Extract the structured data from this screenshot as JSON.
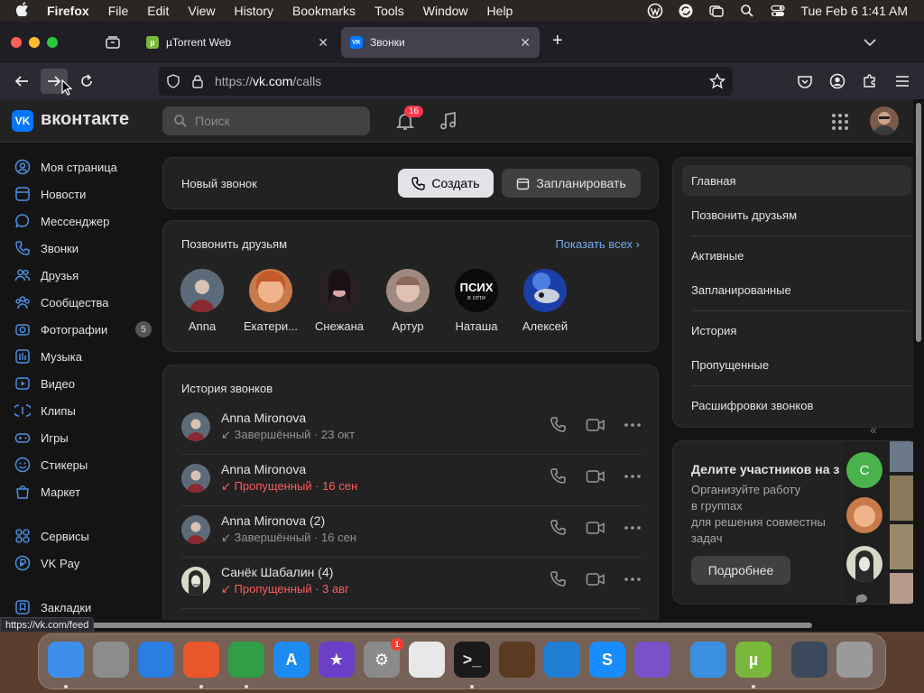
{
  "menubar": {
    "app": "Firefox",
    "items": [
      "File",
      "Edit",
      "View",
      "History",
      "Bookmarks",
      "Tools",
      "Window",
      "Help"
    ],
    "clock": "Tue Feb 6  1:41 AM"
  },
  "tabs": [
    {
      "title": "µTorrent Web",
      "favicon": "µ"
    },
    {
      "title": "Звонки",
      "favicon": "VK"
    }
  ],
  "url": {
    "prefix": "https://",
    "host": "vk.com",
    "path": "/calls"
  },
  "vk": {
    "brand": "вконтакте",
    "logo": "VK",
    "search_placeholder": "Поиск",
    "notifications_count": "16"
  },
  "sidebar": {
    "items": [
      {
        "label": "Моя страница",
        "icon": "user-circle-icon"
      },
      {
        "label": "Новости",
        "icon": "news-icon"
      },
      {
        "label": "Мессенджер",
        "icon": "message-icon"
      },
      {
        "label": "Звонки",
        "icon": "phone-icon"
      },
      {
        "label": "Друзья",
        "icon": "friends-icon"
      },
      {
        "label": "Сообщества",
        "icon": "communities-icon"
      },
      {
        "label": "Фотографии",
        "icon": "photo-icon",
        "count": "5"
      },
      {
        "label": "Музыка",
        "icon": "music-icon"
      },
      {
        "label": "Видео",
        "icon": "video-icon"
      },
      {
        "label": "Клипы",
        "icon": "clips-icon"
      },
      {
        "label": "Игры",
        "icon": "gamepad-icon"
      },
      {
        "label": "Стикеры",
        "icon": "sticker-icon"
      },
      {
        "label": "Маркет",
        "icon": "market-icon"
      },
      {
        "label": "Сервисы",
        "icon": "services-icon"
      },
      {
        "label": "VK Pay",
        "icon": "vkpay-icon"
      },
      {
        "label": "Закладки",
        "icon": "bookmark-icon"
      }
    ]
  },
  "new_call": {
    "title": "Новый звонок",
    "create": "Создать",
    "schedule": "Запланировать"
  },
  "friends": {
    "title": "Позвонить друзьям",
    "show_all": "Показать всех",
    "list": [
      {
        "name": "Anna",
        "color": "#9a8c86"
      },
      {
        "name": "Екатери...",
        "color": "#e08e5f"
      },
      {
        "name": "Снежана",
        "color": "#6b4a52"
      },
      {
        "name": "Артур",
        "color": "#b89a8c"
      },
      {
        "name": "Наташа",
        "color": "#0a0a0a",
        "avatar_text": "ПСИХ",
        "avatar_sub": "в сети"
      },
      {
        "name": "Алексей",
        "color": "#2f4fb0"
      }
    ]
  },
  "history": {
    "title": "История звонков",
    "rows": [
      {
        "name": "Anna Mironova",
        "status": "Завершённый · 23 окт",
        "missed": false
      },
      {
        "name": "Anna Mironova",
        "status": "Пропущенный · 16 сен",
        "missed": true
      },
      {
        "name": "Anna Mironova (2)",
        "status": "Завершённый · 16 сен",
        "missed": false
      },
      {
        "name": "Санёк Шабалин (4)",
        "status": "Пропущенный · 3 авг",
        "missed": true
      }
    ]
  },
  "right_nav": {
    "items": [
      "Главная",
      "Позвонить друзьям",
      "Активные",
      "Запланированные",
      "История",
      "Пропущенные",
      "Расшифровки звонков"
    ]
  },
  "promo": {
    "title": "Делите участников на з",
    "text_lines": [
      "Организуйте работу",
      "в группах",
      "для решения совместны",
      "задач"
    ],
    "button": "Подробнее",
    "avatar_letter": "С"
  },
  "status_link": "https://vk.com/feed",
  "dock": {
    "apps": [
      {
        "name": "finder-icon",
        "color": "#3d8ee8",
        "glyph": ""
      },
      {
        "name": "launchpad-icon",
        "color": "#8c8c8c",
        "glyph": ""
      },
      {
        "name": "safari-icon",
        "color": "#2a7de1",
        "glyph": ""
      },
      {
        "name": "firefox-icon",
        "color": "#e8562a",
        "glyph": ""
      },
      {
        "name": "chrome-icon",
        "color": "#2f9e46",
        "glyph": ""
      },
      {
        "name": "app-store-icon",
        "color": "#1c8bf2",
        "glyph": "A"
      },
      {
        "name": "imovie-icon",
        "color": "#6c3fc9",
        "glyph": "★"
      },
      {
        "name": "system-settings-icon",
        "color": "#8a8a8a",
        "glyph": "⚙",
        "badge": "1"
      },
      {
        "name": "textedit-icon",
        "color": "#e8e8e8",
        "glyph": ""
      },
      {
        "name": "terminal-icon",
        "color": "#1a1a1a",
        "glyph": ">_"
      },
      {
        "name": "garageband-icon",
        "color": "#5a3b20",
        "glyph": ""
      },
      {
        "name": "vscode-icon",
        "color": "#1f7fd4",
        "glyph": ""
      },
      {
        "name": "shazam-icon",
        "color": "#1a8cff",
        "glyph": "S"
      },
      {
        "name": "visual-studio-icon",
        "color": "#7a52c7",
        "glyph": ""
      },
      {
        "name": "weather-icon",
        "color": "#3a8fe0",
        "glyph": ""
      },
      {
        "name": "utorrent-icon",
        "color": "#79b83a",
        "glyph": "µ"
      },
      {
        "name": "downloads-stack-icon",
        "color": "#3a4a5c",
        "glyph": ""
      },
      {
        "name": "trash-icon",
        "color": "#9a9a9a",
        "glyph": ""
      }
    ]
  }
}
